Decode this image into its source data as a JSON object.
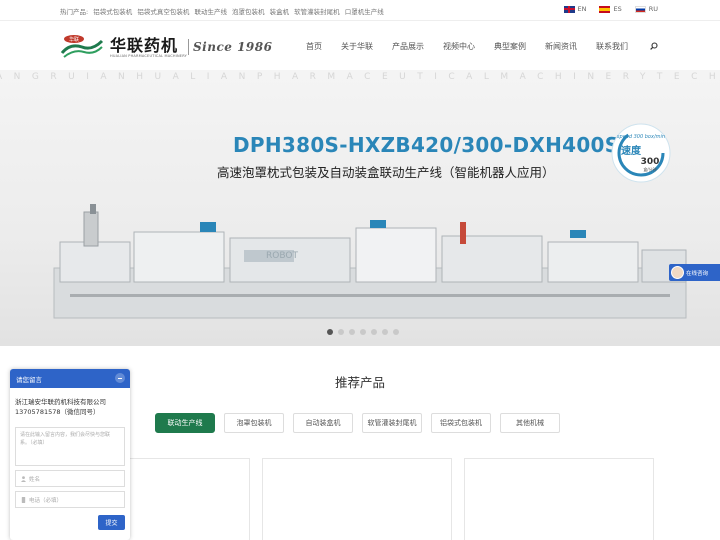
{
  "topbar": {
    "hot_label": "热门产品:",
    "hot_links": [
      "铝袋式包装机",
      "铝袋式真空包装机",
      "联动生产线",
      "泡罩包装机",
      "装盒机",
      "软管灌装封尾机",
      "口罩机生产线"
    ],
    "languages": [
      {
        "code": "EN",
        "flag": "flag-en"
      },
      {
        "code": "ES",
        "flag": "flag-es"
      },
      {
        "code": "RU",
        "flag": "flag-ru"
      }
    ]
  },
  "header": {
    "logo_cn": "华联药机",
    "logo_en": "HUALIAN PHARMACEUTICAL MACHINERY",
    "slogan": "Since 1986",
    "nav": [
      "首页",
      "关于华联",
      "产品展示",
      "视频中心",
      "典型案例",
      "新闻资讯",
      "联系我们"
    ]
  },
  "hero": {
    "watermark": "ANGRUIANHUALIANPHARMACEUTICALMACHINERYTECHNOLOGY",
    "title": "DPH380S-HXZB420/300-DXH400S",
    "subtitle": "高速泡罩枕式包装及自动装盒联动生产线（智能机器人应用）",
    "badge_top": "speed 300 box/min",
    "badge_word": "速度",
    "badge_value": "300",
    "badge_unit": "盒/分钟",
    "machine_label": "ROBOT",
    "slide_count": 7,
    "active_slide": 0
  },
  "online_chat": {
    "label": "在线咨询"
  },
  "recommend": {
    "title": "推荐产品",
    "tabs": [
      "联动生产线",
      "泡罩包装机",
      "自动装盒机",
      "软管灌装封尾机",
      "铝袋式包装机",
      "其他机械"
    ],
    "active_tab": 0
  },
  "message": {
    "title": "请您留言",
    "company": "浙江瑞安华联药机科技有限公司13705781578（微信同号）",
    "textarea_placeholder": "请在此输入留言内容，我们会尽快与您联系。（必填）",
    "name_placeholder": "姓名",
    "phone_placeholder": "电话（必填）",
    "submit": "提交"
  },
  "colors": {
    "brand_blue": "#2a86b8",
    "active_green": "#1f7a4d",
    "widget_blue": "#2e64c8"
  }
}
